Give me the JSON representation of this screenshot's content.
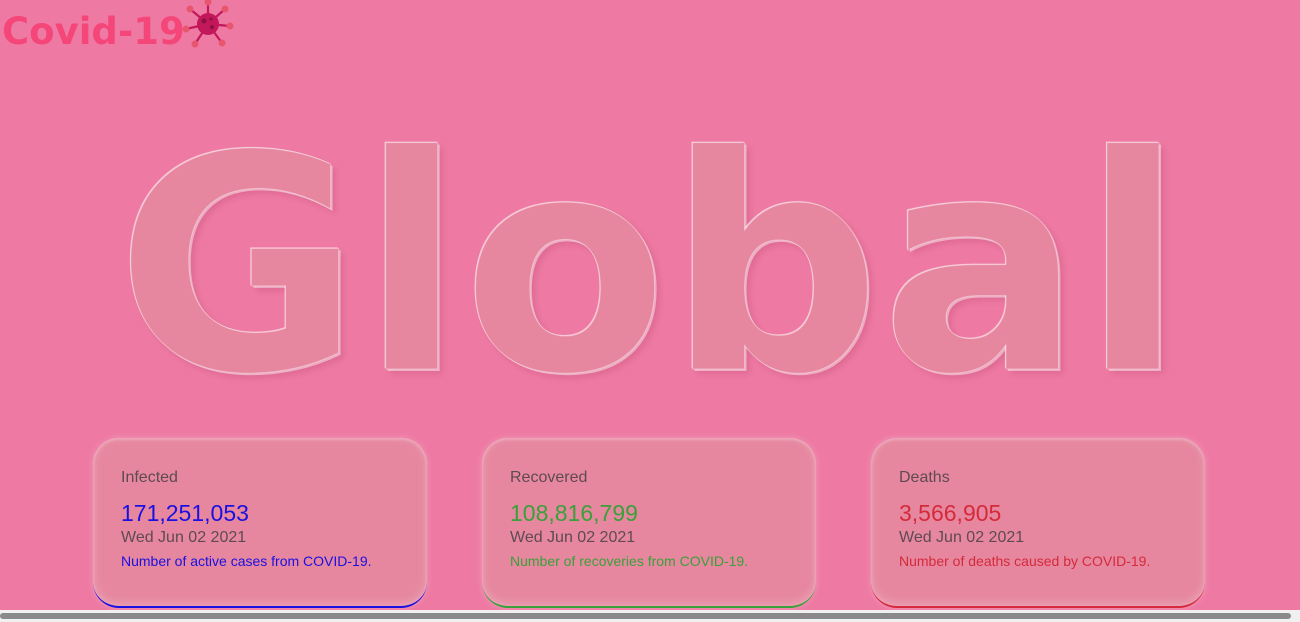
{
  "header": {
    "logo_text": "Covid-19",
    "logo_icon": "virus-icon"
  },
  "hero": {
    "title": "Global"
  },
  "cards": [
    {
      "title": "Infected",
      "value": "171,251,053",
      "date": "Wed Jun 02 2021",
      "description": "Number of active cases from COVID-19.",
      "color": "#1a10e0"
    },
    {
      "title": "Recovered",
      "value": "108,816,799",
      "date": "Wed Jun 02 2021",
      "description": "Number of recoveries from COVID-19.",
      "color": "#3aa03a"
    },
    {
      "title": "Deaths",
      "value": "3,566,905",
      "date": "Wed Jun 02 2021",
      "description": "Number of deaths caused by COVID-19.",
      "color": "#d42a3a"
    }
  ],
  "theme": {
    "background": "#ee7aa3",
    "logo_color": "#f5467a"
  }
}
